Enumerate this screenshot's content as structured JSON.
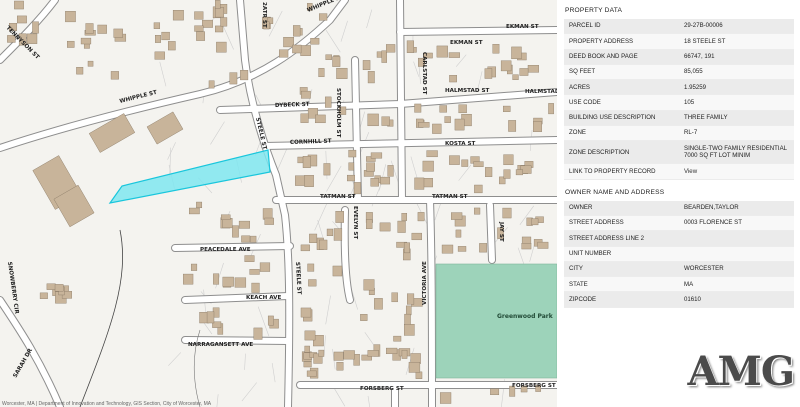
{
  "map": {
    "streets": [
      "WHIPPLE ST",
      "TENNYSON ST",
      "DYBECK ST",
      "STOCKHOLM ST",
      "STEELE ST",
      "CORNHILL ST",
      "CARLSTAD ST",
      "EKMAN ST",
      "HALMSTAD ST",
      "KOSTA ST",
      "TATMAN ST",
      "EVELYN ST",
      "JAY ST",
      "PEACEDALE AVE",
      "KEACH AVE",
      "VICTORIA AVE",
      "SNOWBERRY CIR",
      "SARAH DR",
      "NARRAGANSETT AVE",
      "FORSBERG ST",
      "2ATR ST"
    ],
    "park_name": "Greenwood Park",
    "attribution": "Worcester, MA | Department of Innovation and Technology, GIS Section, City of Worcester, MA",
    "colors": {
      "parcel_highlight": "#7fe6f0",
      "parcel_stroke": "#19c6dc",
      "park": "#9dd3ba",
      "background": "#f4f3ef"
    }
  },
  "property": {
    "title": "PROPERTY DATA",
    "rows": [
      {
        "label": "PARCEL ID",
        "value": "29-27B-00006"
      },
      {
        "label": "PROPERTY ADDRESS",
        "value": "18 STEELE ST"
      },
      {
        "label": "DEED BOOK AND PAGE",
        "value": "66747, 191"
      },
      {
        "label": "SQ FEET",
        "value": "85,055"
      },
      {
        "label": "ACRES",
        "value": "1.95259"
      },
      {
        "label": "USE CODE",
        "value": "105"
      },
      {
        "label": "BUILDING USE DESCRIPTION",
        "value": "THREE FAMILY"
      },
      {
        "label": "ZONE",
        "value": "RL-7"
      },
      {
        "label": "ZONE DESCRIPTION",
        "value": "SINGLE-TWO FAMILY RESIDENTIAL 7000 SQ FT LOT MINIM"
      },
      {
        "label": "LINK TO PROPERTY RECORD",
        "value": "View"
      }
    ]
  },
  "owner": {
    "title": "OWNER NAME AND ADDRESS",
    "rows": [
      {
        "label": "OWNER",
        "value": "BEARDEN,TAYLOR"
      },
      {
        "label": "STREET ADDRESS",
        "value": "0003 FLORENCE ST"
      },
      {
        "label": "STREET ADDRESS LINE 2",
        "value": ""
      },
      {
        "label": "UNIT NUMBER",
        "value": ""
      },
      {
        "label": "CITY",
        "value": "WORCESTER"
      },
      {
        "label": "STATE",
        "value": "MA"
      },
      {
        "label": "ZIPCODE",
        "value": "01610"
      }
    ]
  },
  "logo": {
    "text": "AMG"
  }
}
